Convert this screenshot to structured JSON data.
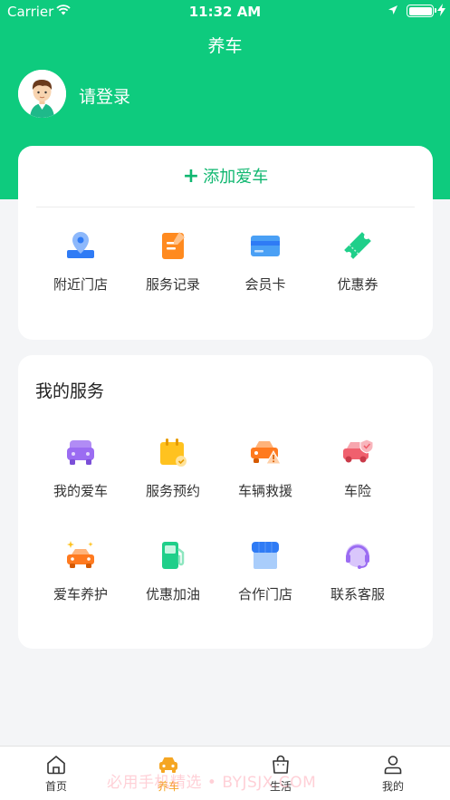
{
  "status_bar": {
    "carrier": "Carrier",
    "time": "11:32 AM"
  },
  "nav": {
    "title": "养车"
  },
  "user": {
    "login_text": "请登录"
  },
  "garage": {
    "add_car_icon": "plus-icon",
    "add_car_label": "添加爱车",
    "shortcuts": [
      {
        "label": "附近门店",
        "icon": "map-pin-icon"
      },
      {
        "label": "服务记录",
        "icon": "notepad-icon"
      },
      {
        "label": "会员卡",
        "icon": "card-icon"
      },
      {
        "label": "优惠券",
        "icon": "ticket-icon"
      }
    ]
  },
  "services": {
    "title": "我的服务",
    "items": [
      {
        "label": "我的爱车",
        "icon": "car-icon"
      },
      {
        "label": "服务预约",
        "icon": "calendar-icon"
      },
      {
        "label": "车辆救援",
        "icon": "rescue-car-icon"
      },
      {
        "label": "车险",
        "icon": "insurance-car-icon"
      },
      {
        "label": "爱车养护",
        "icon": "car-care-icon"
      },
      {
        "label": "优惠加油",
        "icon": "fuel-pump-icon"
      },
      {
        "label": "合作门店",
        "icon": "store-icon"
      },
      {
        "label": "联系客服",
        "icon": "headset-icon"
      }
    ]
  },
  "tabbar": {
    "tabs": [
      {
        "label": "首页",
        "icon": "home-icon",
        "active": false
      },
      {
        "label": "养车",
        "icon": "car-tab-icon",
        "active": true
      },
      {
        "label": "生活",
        "icon": "bag-icon",
        "active": false
      },
      {
        "label": "我的",
        "icon": "person-icon",
        "active": false
      }
    ]
  },
  "colors": {
    "brand": "#0ecb7e",
    "accent": "#f5a623",
    "add_car": "#10b770"
  },
  "watermark": "必用手机精选 • BYJSJX.COM"
}
